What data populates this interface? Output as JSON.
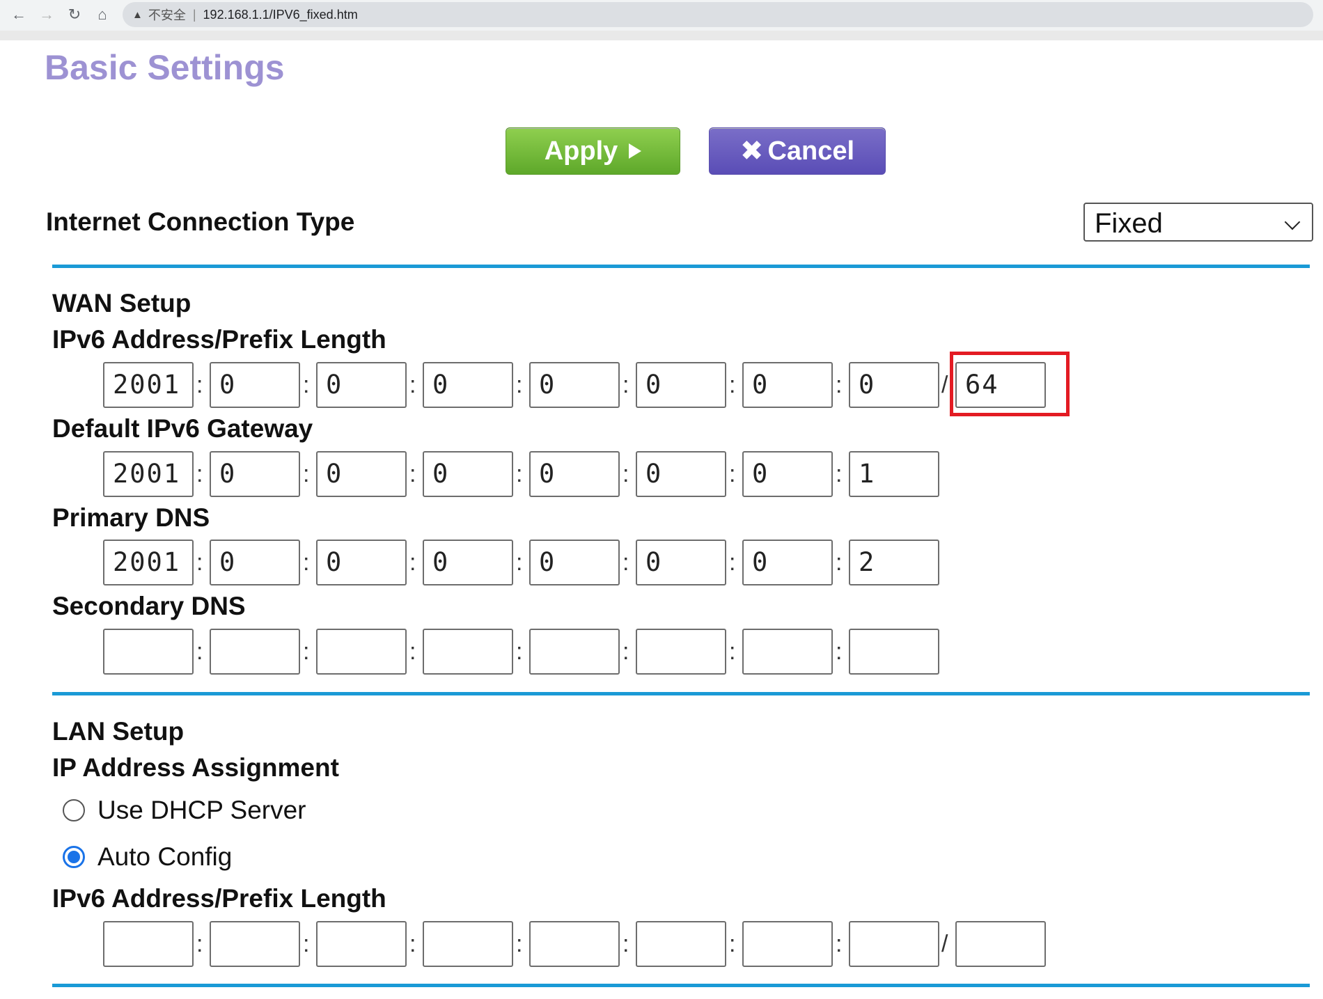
{
  "browser": {
    "security_label": "不安全",
    "url": "192.168.1.1/IPV6_fixed.htm"
  },
  "page": {
    "title": "Basic Settings"
  },
  "buttons": {
    "apply": "Apply",
    "cancel": "Cancel"
  },
  "connection": {
    "label": "Internet Connection Type",
    "selected": "Fixed"
  },
  "wan": {
    "title": "WAN Setup",
    "address_label": "IPv6 Address/Prefix Length",
    "address": [
      "2001",
      "0",
      "0",
      "0",
      "0",
      "0",
      "0",
      "0"
    ],
    "prefix": "64",
    "gateway_label": "Default IPv6 Gateway",
    "gateway": [
      "2001",
      "0",
      "0",
      "0",
      "0",
      "0",
      "0",
      "1"
    ],
    "primary_dns_label": "Primary DNS",
    "primary_dns": [
      "2001",
      "0",
      "0",
      "0",
      "0",
      "0",
      "0",
      "2"
    ],
    "secondary_dns_label": "Secondary DNS",
    "secondary_dns": [
      "",
      "",
      "",
      "",
      "",
      "",
      "",
      ""
    ]
  },
  "lan": {
    "title": "LAN Setup",
    "assignment_label": "IP Address Assignment",
    "option_dhcp": "Use DHCP Server",
    "option_auto": "Auto Config",
    "selected_option": "Auto Config",
    "address_label": "IPv6 Address/Prefix Length",
    "address": [
      "",
      "",
      "",
      "",
      "",
      "",
      "",
      ""
    ],
    "prefix": ""
  },
  "colors": {
    "title": "#9d92d3",
    "apply": "#6fb83a",
    "cancel": "#6358c0",
    "rule": "#1a9ad6",
    "highlight": "#e31b23"
  }
}
